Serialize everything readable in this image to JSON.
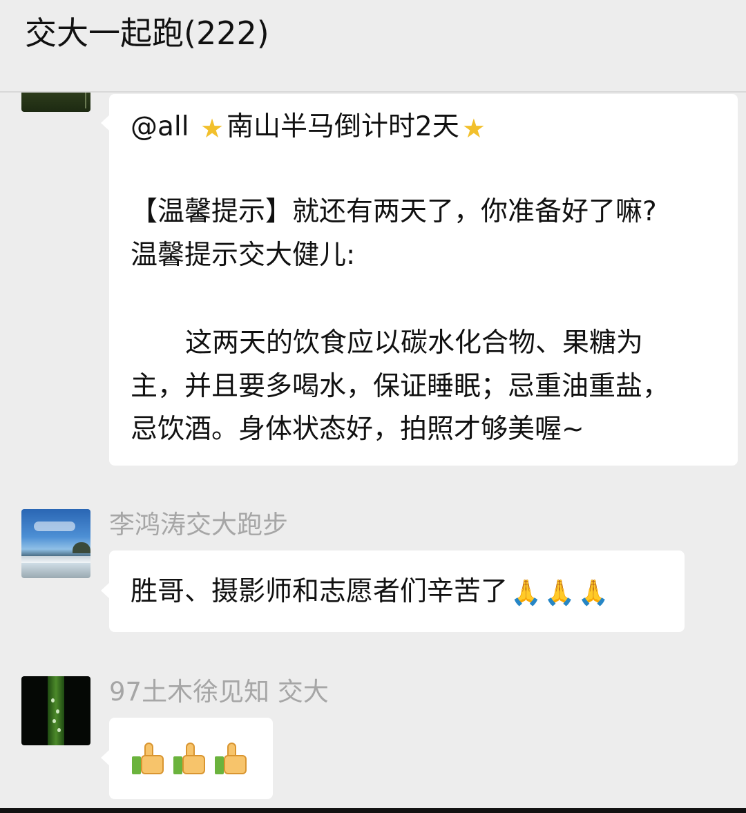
{
  "header": {
    "title": "交大一起跑(222)"
  },
  "messages": [
    {
      "lines": [
        {
          "pre": "@all ",
          "icon_a": "sparkle-star",
          "text": "南山半马倒计时2天",
          "icon_b": "sparkle-star"
        },
        {
          "text": "【温馨提示】就还有两天了，你准备好了嘛?"
        },
        {
          "text": "温馨提示交大健儿:"
        },
        {
          "text": "这两天的饮食应以碳水化合物、果糖为"
        },
        {
          "text": "主，并且要多喝水，保证睡眠；忌重油重盐，"
        },
        {
          "text": "忌饮酒。身体状态好，拍照才够美喔~"
        }
      ],
      "colors": {
        "star": "#f2c02c"
      }
    },
    {
      "sender": "李鸿涛交大跑步",
      "text": "胜哥、摄影师和志愿者们辛苦了",
      "icons": [
        "praying-hands-icon",
        "praying-hands-icon",
        "praying-hands-icon"
      ]
    },
    {
      "sender": "97土木徐见知 交大",
      "icons": [
        "thumbs-up-icon",
        "thumbs-up-icon",
        "thumbs-up-icon"
      ]
    }
  ],
  "colors": {
    "background": "#ededed",
    "bubble": "#ffffff",
    "sender": "#a6a6a6"
  }
}
